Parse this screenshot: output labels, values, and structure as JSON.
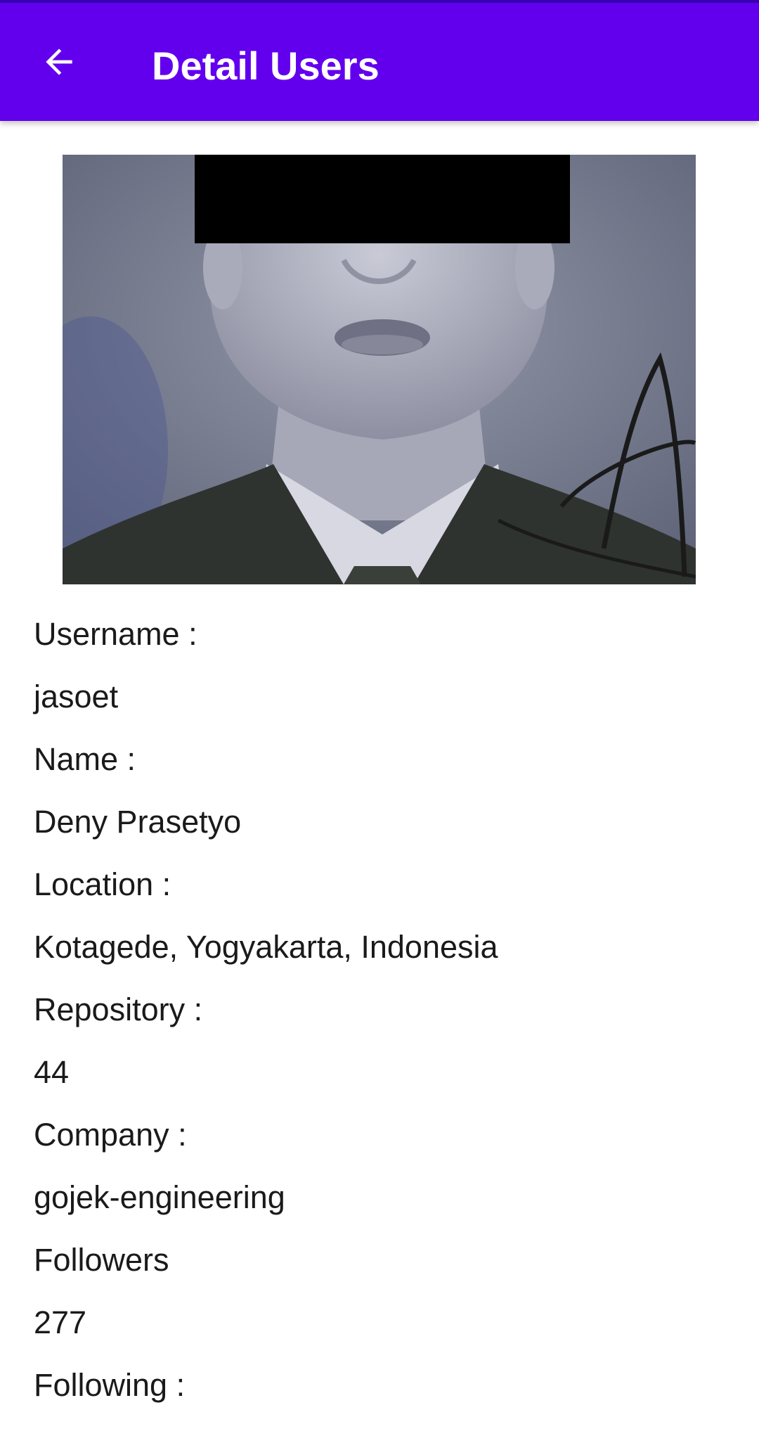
{
  "appbar": {
    "title": "Detail Users",
    "back_icon": "arrow-left-icon",
    "color": "#6200ee",
    "status_color": "#3700b3"
  },
  "profile": {
    "photo": "avatar-photo",
    "rows": [
      {
        "label": "Username :",
        "value": "jasoet"
      },
      {
        "label": "Name :",
        "value": "Deny Prasetyo"
      },
      {
        "label": "Location :",
        "value": "Kotagede, Yogyakarta, Indonesia"
      },
      {
        "label": "Repository :",
        "value": "44"
      },
      {
        "label": "Company :",
        "value": "gojek-engineering"
      },
      {
        "label": "Followers",
        "value": "277"
      },
      {
        "label": "Following :"
      }
    ]
  }
}
